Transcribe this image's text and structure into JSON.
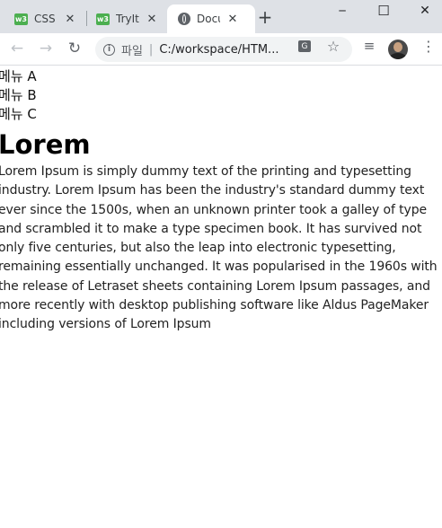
{
  "browser": {
    "tabs": [
      {
        "favicon": "w3",
        "title": "CSS",
        "close": "✕"
      },
      {
        "favicon": "w3",
        "title": "TryIt",
        "close": "✕"
      },
      {
        "favicon": "globe",
        "title": "Document",
        "close": "✕"
      }
    ],
    "new_tab": "+",
    "window_controls": {
      "minimize": "─",
      "maximize": "☐",
      "close": "✕"
    },
    "nav": {
      "back": "←",
      "forward": "→",
      "reload": "↻"
    },
    "address": {
      "info": "i",
      "scheme_label": "파일",
      "separator": "|",
      "url": "C:/workspace/HTM..."
    },
    "toolbar_icons": {
      "translate": "G",
      "bookmark": "☆",
      "media": "≡",
      "menu": "⋮"
    }
  },
  "page": {
    "menu_items": [
      "메뉴 A",
      "메뉴 B",
      "메뉴 C"
    ],
    "heading": "Lorem",
    "paragraph": "Lorem Ipsum is simply dummy text of the printing and typesetting industry. Lorem Ipsum has been the industry's standard dummy text ever since the 1500s, when an unknown printer took a galley of type and scrambled it to make a type specimen book. It has survived not only five centuries, but also the leap into electronic typesetting, remaining essentially unchanged. It was popularised in the 1960s with the release of Letraset sheets containing Lorem Ipsum passages, and more recently with desktop publishing software like Aldus PageMaker including versions of Lorem Ipsum"
  }
}
